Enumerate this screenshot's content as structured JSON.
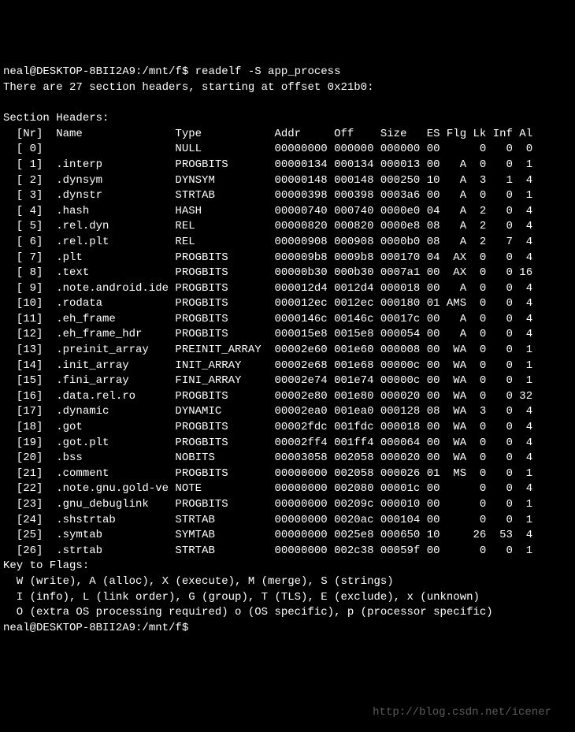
{
  "prompt": "neal@DESKTOP-8BII2A9:/mnt/f$ ",
  "command": "readelf -S app_process",
  "intro": "There are 27 section headers, starting at offset 0x21b0:",
  "header_label": "Section Headers:",
  "cols": [
    "[Nr]",
    "Name",
    "Type",
    "Addr",
    "Off",
    "Size",
    "ES",
    "Flg",
    "Lk",
    "Inf",
    "Al"
  ],
  "rows": [
    {
      "nr": "[ 0]",
      "name": "",
      "type": "NULL",
      "addr": "00000000",
      "off": "000000",
      "size": "000000",
      "es": "00",
      "flg": "",
      "lk": "0",
      "inf": "0",
      "al": "0"
    },
    {
      "nr": "[ 1]",
      "name": ".interp",
      "type": "PROGBITS",
      "addr": "00000134",
      "off": "000134",
      "size": "000013",
      "es": "00",
      "flg": "A",
      "lk": "0",
      "inf": "0",
      "al": "1"
    },
    {
      "nr": "[ 2]",
      "name": ".dynsym",
      "type": "DYNSYM",
      "addr": "00000148",
      "off": "000148",
      "size": "000250",
      "es": "10",
      "flg": "A",
      "lk": "3",
      "inf": "1",
      "al": "4"
    },
    {
      "nr": "[ 3]",
      "name": ".dynstr",
      "type": "STRTAB",
      "addr": "00000398",
      "off": "000398",
      "size": "0003a6",
      "es": "00",
      "flg": "A",
      "lk": "0",
      "inf": "0",
      "al": "1"
    },
    {
      "nr": "[ 4]",
      "name": ".hash",
      "type": "HASH",
      "addr": "00000740",
      "off": "000740",
      "size": "0000e0",
      "es": "04",
      "flg": "A",
      "lk": "2",
      "inf": "0",
      "al": "4"
    },
    {
      "nr": "[ 5]",
      "name": ".rel.dyn",
      "type": "REL",
      "addr": "00000820",
      "off": "000820",
      "size": "0000e8",
      "es": "08",
      "flg": "A",
      "lk": "2",
      "inf": "0",
      "al": "4"
    },
    {
      "nr": "[ 6]",
      "name": ".rel.plt",
      "type": "REL",
      "addr": "00000908",
      "off": "000908",
      "size": "0000b0",
      "es": "08",
      "flg": "A",
      "lk": "2",
      "inf": "7",
      "al": "4"
    },
    {
      "nr": "[ 7]",
      "name": ".plt",
      "type": "PROGBITS",
      "addr": "000009b8",
      "off": "0009b8",
      "size": "000170",
      "es": "04",
      "flg": "AX",
      "lk": "0",
      "inf": "0",
      "al": "4"
    },
    {
      "nr": "[ 8]",
      "name": ".text",
      "type": "PROGBITS",
      "addr": "00000b30",
      "off": "000b30",
      "size": "0007a1",
      "es": "00",
      "flg": "AX",
      "lk": "0",
      "inf": "0",
      "al": "16"
    },
    {
      "nr": "[ 9]",
      "name": ".note.android.ide",
      "type": "PROGBITS",
      "addr": "000012d4",
      "off": "0012d4",
      "size": "000018",
      "es": "00",
      "flg": "A",
      "lk": "0",
      "inf": "0",
      "al": "4"
    },
    {
      "nr": "[10]",
      "name": ".rodata",
      "type": "PROGBITS",
      "addr": "000012ec",
      "off": "0012ec",
      "size": "000180",
      "es": "01",
      "flg": "AMS",
      "lk": "0",
      "inf": "0",
      "al": "4"
    },
    {
      "nr": "[11]",
      "name": ".eh_frame",
      "type": "PROGBITS",
      "addr": "0000146c",
      "off": "00146c",
      "size": "00017c",
      "es": "00",
      "flg": "A",
      "lk": "0",
      "inf": "0",
      "al": "4"
    },
    {
      "nr": "[12]",
      "name": ".eh_frame_hdr",
      "type": "PROGBITS",
      "addr": "000015e8",
      "off": "0015e8",
      "size": "000054",
      "es": "00",
      "flg": "A",
      "lk": "0",
      "inf": "0",
      "al": "4"
    },
    {
      "nr": "[13]",
      "name": ".preinit_array",
      "type": "PREINIT_ARRAY",
      "addr": "00002e60",
      "off": "001e60",
      "size": "000008",
      "es": "00",
      "flg": "WA",
      "lk": "0",
      "inf": "0",
      "al": "1"
    },
    {
      "nr": "[14]",
      "name": ".init_array",
      "type": "INIT_ARRAY",
      "addr": "00002e68",
      "off": "001e68",
      "size": "00000c",
      "es": "00",
      "flg": "WA",
      "lk": "0",
      "inf": "0",
      "al": "1"
    },
    {
      "nr": "[15]",
      "name": ".fini_array",
      "type": "FINI_ARRAY",
      "addr": "00002e74",
      "off": "001e74",
      "size": "00000c",
      "es": "00",
      "flg": "WA",
      "lk": "0",
      "inf": "0",
      "al": "1"
    },
    {
      "nr": "[16]",
      "name": ".data.rel.ro",
      "type": "PROGBITS",
      "addr": "00002e80",
      "off": "001e80",
      "size": "000020",
      "es": "00",
      "flg": "WA",
      "lk": "0",
      "inf": "0",
      "al": "32"
    },
    {
      "nr": "[17]",
      "name": ".dynamic",
      "type": "DYNAMIC",
      "addr": "00002ea0",
      "off": "001ea0",
      "size": "000128",
      "es": "08",
      "flg": "WA",
      "lk": "3",
      "inf": "0",
      "al": "4"
    },
    {
      "nr": "[18]",
      "name": ".got",
      "type": "PROGBITS",
      "addr": "00002fdc",
      "off": "001fdc",
      "size": "000018",
      "es": "00",
      "flg": "WA",
      "lk": "0",
      "inf": "0",
      "al": "4"
    },
    {
      "nr": "[19]",
      "name": ".got.plt",
      "type": "PROGBITS",
      "addr": "00002ff4",
      "off": "001ff4",
      "size": "000064",
      "es": "00",
      "flg": "WA",
      "lk": "0",
      "inf": "0",
      "al": "4"
    },
    {
      "nr": "[20]",
      "name": ".bss",
      "type": "NOBITS",
      "addr": "00003058",
      "off": "002058",
      "size": "000020",
      "es": "00",
      "flg": "WA",
      "lk": "0",
      "inf": "0",
      "al": "4"
    },
    {
      "nr": "[21]",
      "name": ".comment",
      "type": "PROGBITS",
      "addr": "00000000",
      "off": "002058",
      "size": "000026",
      "es": "01",
      "flg": "MS",
      "lk": "0",
      "inf": "0",
      "al": "1"
    },
    {
      "nr": "[22]",
      "name": ".note.gnu.gold-ve",
      "type": "NOTE",
      "addr": "00000000",
      "off": "002080",
      "size": "00001c",
      "es": "00",
      "flg": "",
      "lk": "0",
      "inf": "0",
      "al": "4"
    },
    {
      "nr": "[23]",
      "name": ".gnu_debuglink",
      "type": "PROGBITS",
      "addr": "00000000",
      "off": "00209c",
      "size": "000010",
      "es": "00",
      "flg": "",
      "lk": "0",
      "inf": "0",
      "al": "1"
    },
    {
      "nr": "[24]",
      "name": ".shstrtab",
      "type": "STRTAB",
      "addr": "00000000",
      "off": "0020ac",
      "size": "000104",
      "es": "00",
      "flg": "",
      "lk": "0",
      "inf": "0",
      "al": "1"
    },
    {
      "nr": "[25]",
      "name": ".symtab",
      "type": "SYMTAB",
      "addr": "00000000",
      "off": "0025e8",
      "size": "000650",
      "es": "10",
      "flg": "",
      "lk": "26",
      "inf": "53",
      "al": "4"
    },
    {
      "nr": "[26]",
      "name": ".strtab",
      "type": "STRTAB",
      "addr": "00000000",
      "off": "002c38",
      "size": "00059f",
      "es": "00",
      "flg": "",
      "lk": "0",
      "inf": "0",
      "al": "1"
    }
  ],
  "key_label": "Key to Flags:",
  "key_lines": [
    "  W (write), A (alloc), X (execute), M (merge), S (strings)",
    "  I (info), L (link order), G (group), T (TLS), E (exclude), x (unknown)",
    "  O (extra OS processing required) o (OS specific), p (processor specific)"
  ],
  "prompt2": "neal@DESKTOP-8BII2A9:/mnt/f$",
  "watermark": "http://blog.csdn.net/icener"
}
